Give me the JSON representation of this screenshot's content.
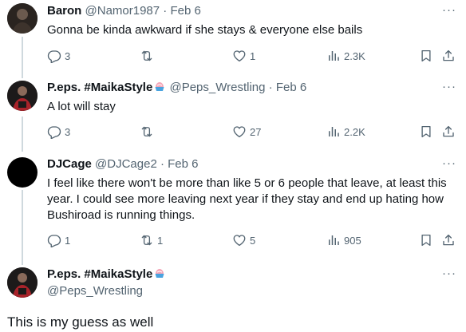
{
  "tweets": [
    {
      "name": "Baron",
      "handle": "@Namor1987",
      "dot": "·",
      "date": "Feb 6",
      "text": "Gonna be kinda awkward if she stays & everyone else bails",
      "replies": "3",
      "retweets": "",
      "likes": "1",
      "views": "2.3K"
    },
    {
      "name": "P.eps. #MaikaStyle",
      "handle": "@Peps_Wrestling",
      "dot": "·",
      "date": "Feb 6",
      "text": "A lot will stay",
      "replies": "3",
      "retweets": "",
      "likes": "27",
      "views": "2.2K"
    },
    {
      "name": "DJCage",
      "handle": "@DJCage2",
      "dot": "·",
      "date": "Feb 6",
      "text": "I feel like there won't be more than like 5 or 6 people that leave, at least this year. I could see more leaving next year if they stay and end up hating how Bushiroad is running things.",
      "replies": "1",
      "retweets": "1",
      "likes": "5",
      "views": "905"
    }
  ],
  "main_tweet": {
    "name": "P.eps. #MaikaStyle",
    "handle": "@Peps_Wrestling",
    "text": "This is my guess as well"
  },
  "icons": {
    "more": "more-icon",
    "reply": "reply-icon",
    "retweet": "retweet-icon",
    "like": "heart-icon",
    "views": "views-icon",
    "bookmark": "bookmark-icon",
    "share": "share-icon"
  },
  "colors": {
    "text": "#0f1419",
    "secondary": "#536471",
    "thread_line": "#cfd9de"
  }
}
